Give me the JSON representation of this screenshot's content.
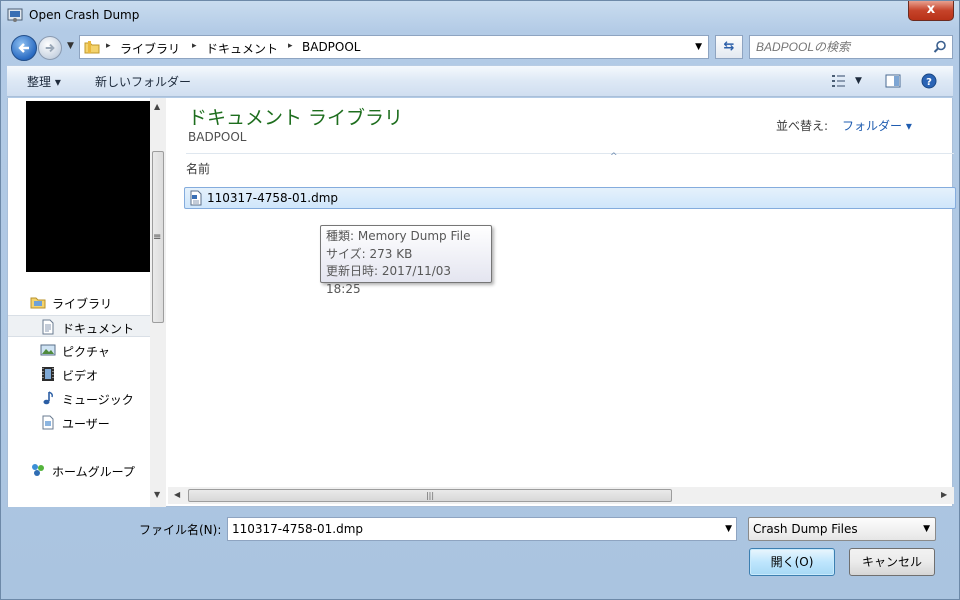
{
  "window": {
    "title": "Open Crash Dump",
    "close_label": "x"
  },
  "nav": {
    "breadcrumbs": [
      "ライブラリ",
      "ドキュメント",
      "BADPOOL"
    ],
    "search_placeholder": "BADPOOLの検索"
  },
  "toolbar": {
    "organize_label": "整理 ▾",
    "new_folder_label": "新しいフォルダー"
  },
  "sidebar": {
    "items": [
      {
        "label": "ライブラリ",
        "icon": "library-icon"
      },
      {
        "label": "ドキュメント",
        "icon": "document-icon",
        "selected": true
      },
      {
        "label": "ピクチャ",
        "icon": "picture-icon"
      },
      {
        "label": "ビデオ",
        "icon": "video-icon"
      },
      {
        "label": "ミュージック",
        "icon": "music-icon"
      },
      {
        "label": "ユーザー",
        "icon": "user-icon"
      },
      {
        "label": "ホームグループ",
        "icon": "homegroup-icon"
      }
    ]
  },
  "content": {
    "library_title": "ドキュメント ライブラリ",
    "library_subtitle": "BADPOOL",
    "sort_label": "並べ替え:",
    "sort_value": "フォルダー ▾",
    "column_header": "名前",
    "files": [
      {
        "name": "110317-4758-01.dmp",
        "selected": true
      }
    ],
    "tooltip": {
      "type": "種類: Memory Dump File",
      "size": "サイズ: 273 KB",
      "modified": "更新日時: 2017/11/03 18:25"
    }
  },
  "bottom": {
    "filename_label": "ファイル名(N):",
    "filename_value": "110317-4758-01.dmp",
    "filter_value": "Crash Dump Files",
    "open_label": "開く(O)",
    "cancel_label": "キャンセル"
  },
  "colors": {
    "accent": "#1e6e1e",
    "link": "#1f5cb0",
    "close": "#c6432a"
  }
}
